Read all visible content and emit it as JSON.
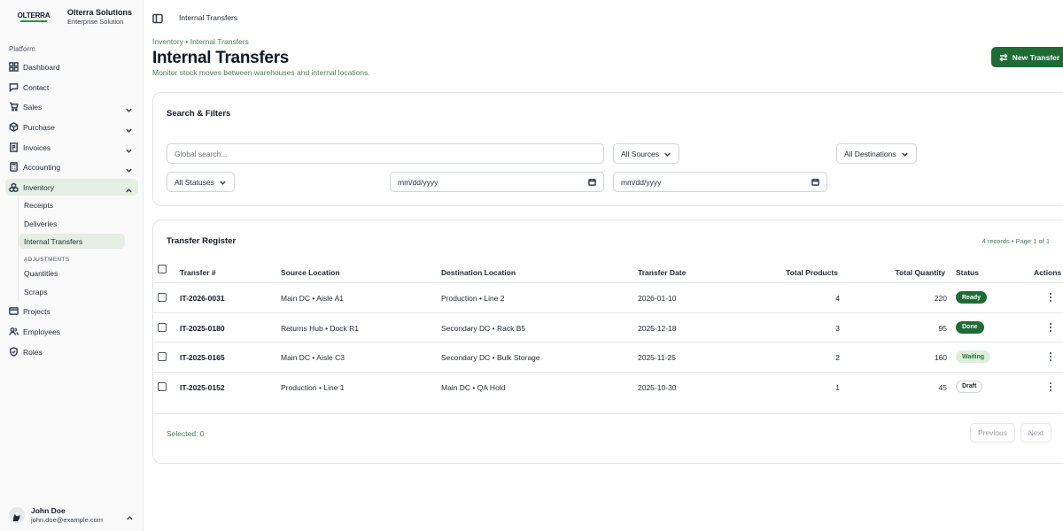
{
  "sidebar": {
    "brand": {
      "logo_text": "OLTERRA",
      "name": "Olterra Solutions",
      "subtitle": "Enterprise Solution"
    },
    "section_label": "Platform",
    "items": [
      {
        "label": "Dashboard",
        "icon": "grid-icon"
      },
      {
        "label": "Contact",
        "icon": "message-icon"
      },
      {
        "label": "Sales",
        "icon": "cart-icon"
      },
      {
        "label": "Purchase",
        "icon": "box-icon"
      },
      {
        "label": "Invoices",
        "icon": "invoice-icon"
      },
      {
        "label": "Accounting",
        "icon": "calculator-icon"
      },
      {
        "label": "Inventory",
        "icon": "boxes-icon"
      },
      {
        "label": "Projects",
        "icon": "folder-icon"
      },
      {
        "label": "Employees",
        "icon": "users-icon"
      },
      {
        "label": "Roles",
        "icon": "shield-icon"
      }
    ],
    "inventory_sub": {
      "items": [
        "Receipts",
        "Deliveries",
        "Internal Transfers"
      ],
      "adjustments_label": "ADJUSTMENTS",
      "adjustments": [
        "Quantities",
        "Scraps"
      ]
    },
    "user": {
      "name": "John Doe",
      "email": "john.doe@example.com"
    }
  },
  "topbar": {
    "title": "Internal Transfers"
  },
  "header": {
    "breadcrumb": [
      "Inventory",
      "Internal Transfers"
    ],
    "breadcrumb_sep": "•",
    "title": "Internal Transfers",
    "subtitle": "Monitor stock moves between warehouses and internal locations.",
    "new_button": "New Transfer"
  },
  "filters": {
    "title": "Search & Filters",
    "search_placeholder": "Global search...",
    "sources": "All Sources",
    "destinations": "All Destinations",
    "statuses": "All Statuses",
    "date_from": "mm/dd/yyyy",
    "date_to": "mm/dd/yyyy"
  },
  "table": {
    "title": "Transfer Register",
    "records": "4 records • Page 1 of 1",
    "columns": [
      "Transfer #",
      "Source Location",
      "Destination Location",
      "Transfer Date",
      "Total Products",
      "Total Quantity",
      "Status",
      "Actions"
    ],
    "rows": [
      {
        "id": "IT-2026-0031",
        "source": "Main DC • Aisle A1",
        "destination": "Production • Line 2",
        "date": "2026-01-10",
        "products": "4",
        "quantity": "220",
        "status": "Ready"
      },
      {
        "id": "IT-2025-0180",
        "source": "Returns Hub • Dock R1",
        "destination": "Secondary DC • Rack B5",
        "date": "2025-12-18",
        "products": "3",
        "quantity": "95",
        "status": "Done"
      },
      {
        "id": "IT-2025-0165",
        "source": "Main DC • Aisle C3",
        "destination": "Secondary DC • Bulk Storage",
        "date": "2025-11-25",
        "products": "2",
        "quantity": "160",
        "status": "Waiting"
      },
      {
        "id": "IT-2025-0152",
        "source": "Production • Line 1",
        "destination": "Main DC • QA Hold",
        "date": "2025-10-30",
        "products": "1",
        "quantity": "45",
        "status": "Draft"
      }
    ],
    "selected": "Selected: 0",
    "prev": "Previous",
    "next": "Next"
  },
  "colors": {
    "primary": "#1e6b36",
    "active_bg": "#e3f0e3",
    "muted_green": "#4d7c57",
    "status_ready_bg": "#1e6b36",
    "status_done_bg": "#1e6b36",
    "status_waiting_bg": "#dcefdc",
    "status_draft_bg": "#ffffff"
  }
}
